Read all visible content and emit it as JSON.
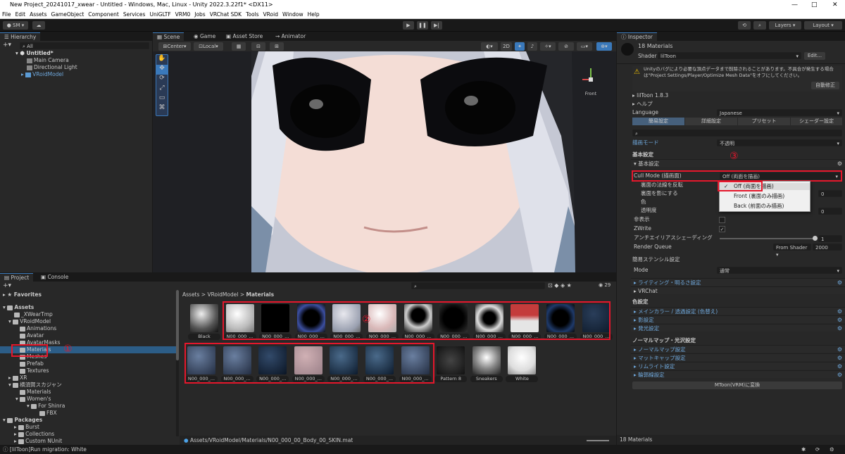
{
  "window": {
    "title": "New Project_20241017_xwear - Untitled - Windows, Mac, Linux - Unity 2022.3.22f1* <DX11>",
    "min": "—",
    "max": "□",
    "close": "✕"
  },
  "menu": [
    "File",
    "Edit",
    "Assets",
    "GameObject",
    "Component",
    "Services",
    "UniGLTF",
    "VRM0",
    "Jobs",
    "VRChat SDK",
    "Tools",
    "VRoid",
    "Window",
    "Help"
  ],
  "toolbar": {
    "account": "SM",
    "layers": "Layers",
    "layout": "Layout"
  },
  "hierarchy": {
    "tab": "Hierarchy",
    "search_placeholder": "All",
    "items": [
      "Untitled*",
      "Main Camera",
      "Directional Light",
      "VRoidModel"
    ]
  },
  "scene": {
    "tabs": [
      "Scene",
      "Game",
      "Asset Store",
      "Animator"
    ],
    "pivot": "Center",
    "space": "Local",
    "mode2d": "2D",
    "persp": "Front"
  },
  "project": {
    "tabs": [
      "Project",
      "Console"
    ],
    "count": "29",
    "tree": [
      "Favorites",
      "Assets",
      "_XWearTmp",
      "VRoidModel",
      "Animations",
      "Avatar",
      "AvatarMasks",
      "Materials",
      "Meshes",
      "Prefab",
      "Textures",
      "XR",
      "横須賀スカジャン",
      "Materials",
      "Women's",
      "For Shinra",
      "FBX",
      "Packages",
      "Burst",
      "Collections",
      "Custom NUnit"
    ],
    "breadcrumb": [
      "Assets",
      "VRoidModel",
      "Materials"
    ],
    "row1": [
      "Black",
      "N00_000_...",
      "N00_000_...",
      "N00_000_...",
      "N00_000_...",
      "N00_000_...",
      "N00_000_...",
      "N00_000_...",
      "N00_000_...",
      "N00_000_...",
      "N00_000_...",
      "N00_000_..."
    ],
    "row2": [
      "N00_000_...",
      "N00_000_...",
      "N00_000_...",
      "N00_000_...",
      "N00_000_...",
      "N00_000_...",
      "N00_000_...",
      "Pattern 8",
      "Sneakers",
      "White"
    ],
    "path": "Assets/VRoidModel/Materials/N00_000_00_Body_00_SKIN.mat"
  },
  "markers": {
    "m1": "①",
    "m2": "②",
    "m3": "③"
  },
  "inspector": {
    "tab": "Inspector",
    "header": "18 Materials",
    "shader_label": "Shader",
    "shader": "lilToon",
    "edit": "Edit...",
    "warning": "Unityのバグにより必要な頂点データまで削除されることがあります。不具合が発生する場合は\"Project Settings/Player/Optimize Mesh Data\"をオフにしてください。",
    "auto_fix": "自動修正",
    "version": "lilToon 1.8.3",
    "help": "ヘルプ",
    "language_label": "Language",
    "language": "Japanese",
    "tabs": [
      "簡易設定",
      "詳細設定",
      "プリセット",
      "シェーダー設定"
    ],
    "render_mode_label": "描画モード",
    "render_mode": "不透明",
    "basic": "基本設定",
    "basic_sub": "基本設定",
    "cull_label": "Cull Mode (描画面)",
    "cull_value": "Off (両面を描画)",
    "rows": [
      "裏面の法線を反転",
      "裏面を影にする",
      "色",
      "透明度",
      "非表示",
      "ZWrite",
      "アンチエイリアスシェーディング",
      "Render Queue"
    ],
    "values": {
      "v0": "0",
      "v1": "0",
      "aa": "1",
      "rq_mode": "From Shader",
      "rq": "2000"
    },
    "dropdown": [
      "Off (両面を描画)",
      "Front (裏面のみ描画)",
      "Back (前面のみ描画)"
    ],
    "stencil": "簡易ステンシル設定",
    "mode_label": "Mode",
    "mode": "通常",
    "sections1": [
      "ライティング・明るさ設定",
      "VRChat"
    ],
    "color_title": "色設定",
    "sections2": [
      "メインカラー / 透過設定 (色替え)",
      "影設定",
      "発光設定"
    ],
    "normal_title": "ノーマルマップ・光沢設定",
    "sections3": [
      "ノーマルマップ設定",
      "マットキャップ設定",
      "リムライト設定",
      "輪郭線設定"
    ],
    "mtoon": "MToon(VRM)に変換",
    "footer": "18 Materials"
  },
  "status": "[lilToon]Run migration: White"
}
